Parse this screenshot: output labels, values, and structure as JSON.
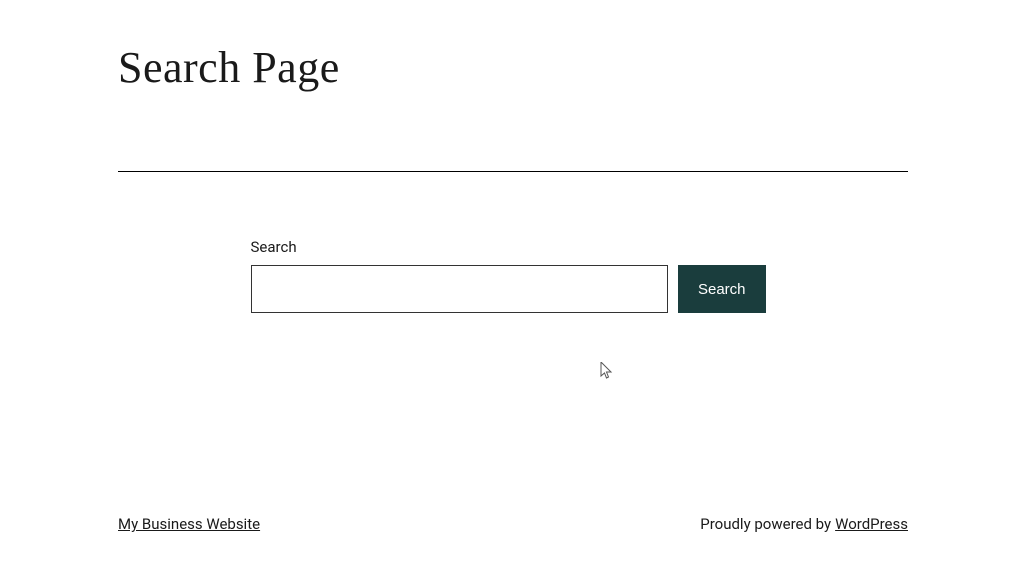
{
  "header": {
    "title": "Search Page"
  },
  "search": {
    "label": "Search",
    "input_value": "",
    "button_label": "Search"
  },
  "footer": {
    "site_link": "My Business Website",
    "powered_text": "Proudly powered by ",
    "powered_link": "WordPress"
  },
  "colors": {
    "button_bg": "#1a3d3d",
    "text": "#1a1a1a"
  }
}
